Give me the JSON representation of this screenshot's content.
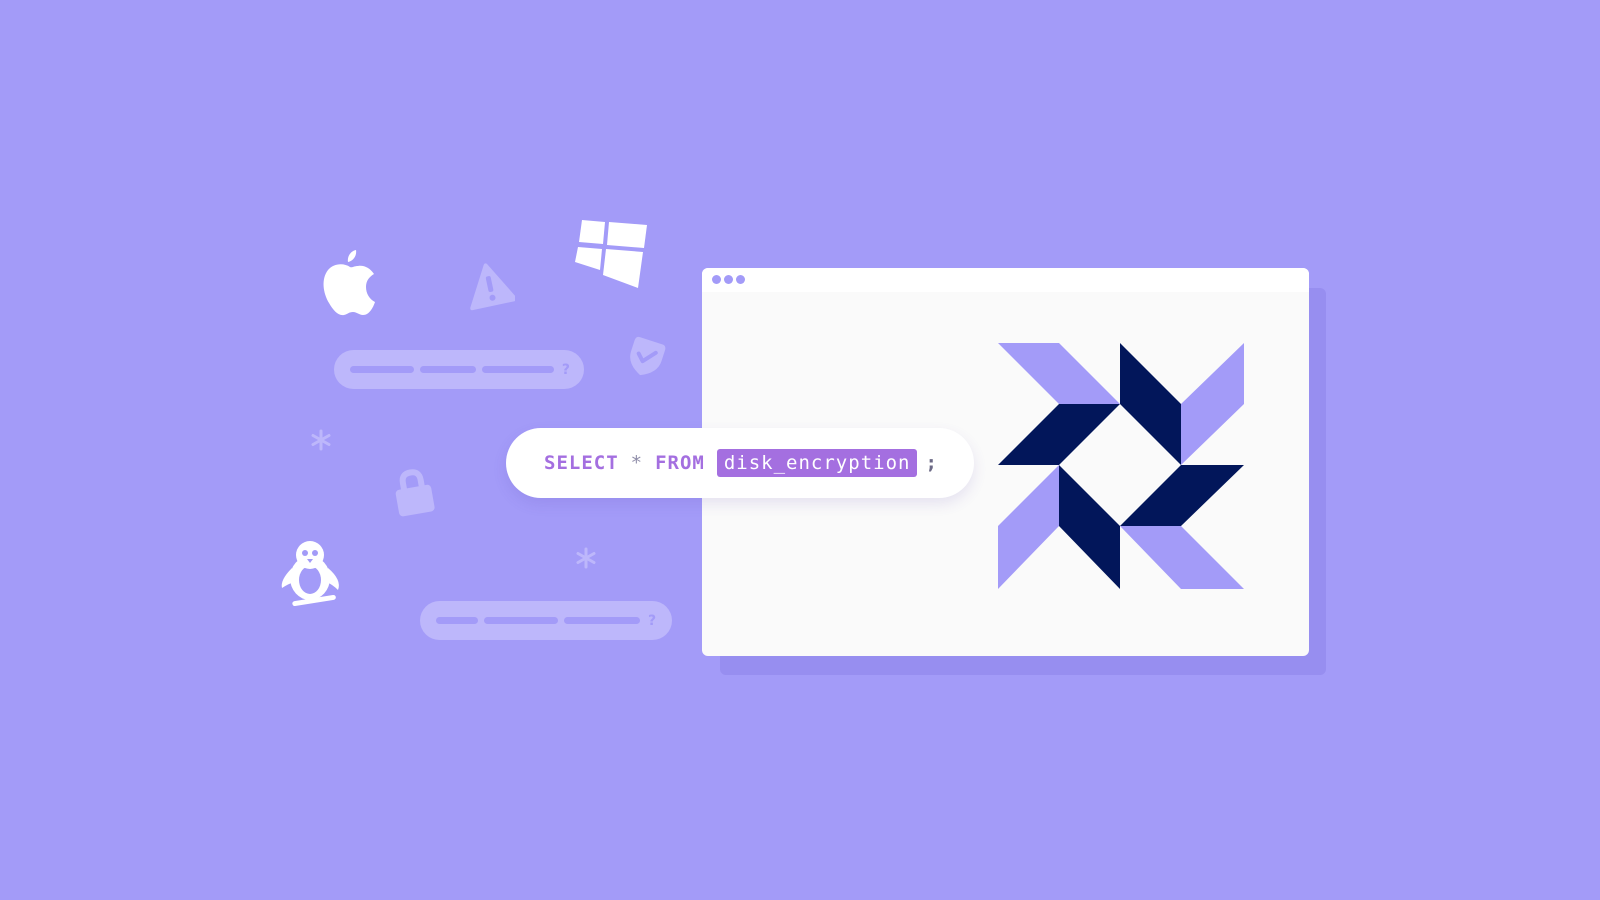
{
  "query": {
    "select": "SELECT",
    "star": "*",
    "from": "FROM",
    "table": "disk_encryption",
    "semicolon": ";"
  },
  "search_pills": [
    {
      "suffix": "?"
    },
    {
      "suffix": "?"
    }
  ],
  "colors": {
    "background": "#a39bf8",
    "keyword": "#a46fe0",
    "logo_dark": "#02165a",
    "logo_light": "#a39bf8"
  },
  "icons": [
    "apple-icon",
    "warning-icon",
    "windows-icon",
    "shield-check-icon",
    "asterisk-icon",
    "lock-icon",
    "linux-penguin-icon",
    "osquery-logo"
  ]
}
